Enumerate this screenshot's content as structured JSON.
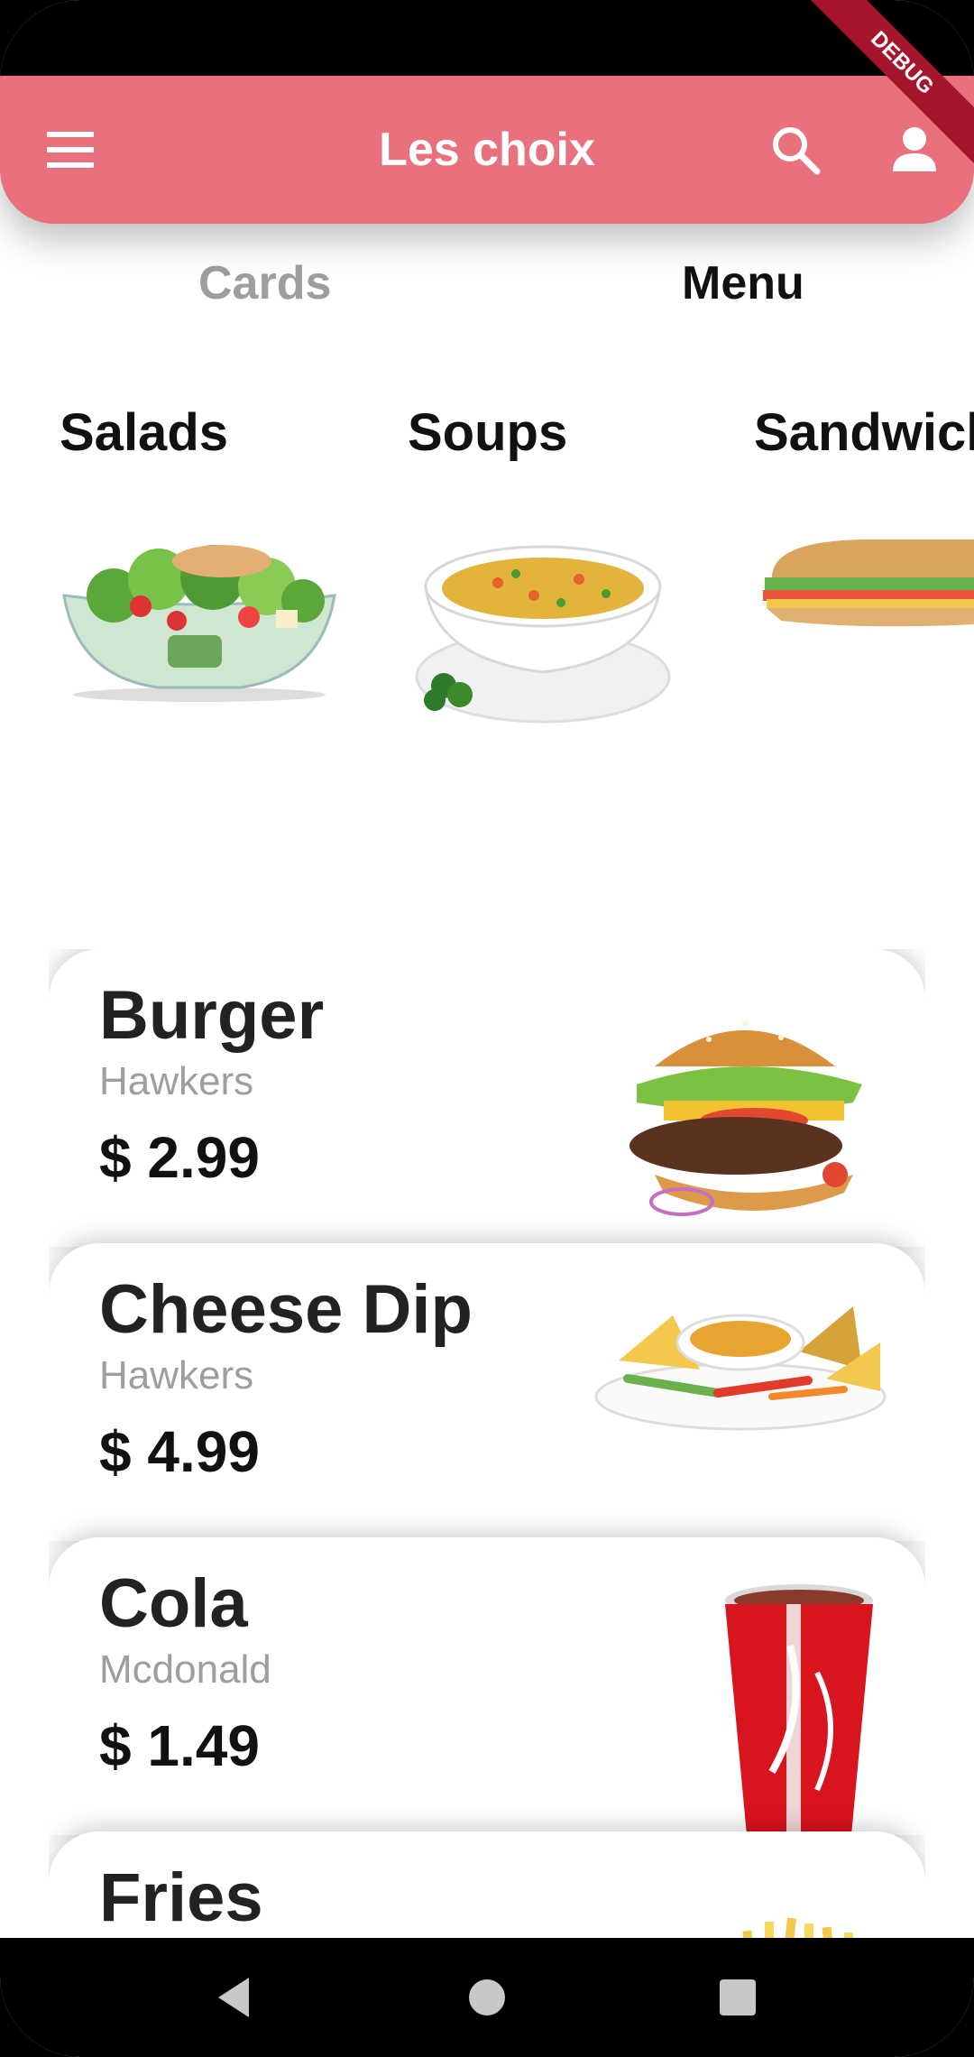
{
  "app_bar": {
    "title": "Les choix",
    "color": "#e8717d",
    "menu_icon": "menu-icon",
    "search_icon": "search-icon",
    "profile_icon": "person-icon"
  },
  "debug_banner": "DEBUG",
  "tabs": [
    {
      "label": "Cards",
      "selected": false
    },
    {
      "label": "Menu",
      "selected": true
    }
  ],
  "categories": [
    {
      "label": "Salads",
      "image": "salad-bowl"
    },
    {
      "label": "Soups",
      "image": "soup-bowl"
    },
    {
      "label": "Sandwiches",
      "image": "sub-sandwich"
    }
  ],
  "cards": [
    {
      "name": "Burger",
      "vendor": "Hawkers",
      "price": "$ 2.99",
      "image": "burger"
    },
    {
      "name": "Cheese Dip",
      "vendor": "Hawkers",
      "price": "$ 4.99",
      "image": "cheese-dip-platter"
    },
    {
      "name": "Cola",
      "vendor": "Mcdonald",
      "price": "$ 1.49",
      "image": "cola-cup"
    },
    {
      "name": "Fries",
      "vendor": "",
      "price": "",
      "image": "fries"
    }
  ],
  "nav_bar": {
    "back_icon": "back-triangle-icon",
    "home_icon": "home-circle-icon",
    "recent_icon": "recent-square-icon"
  }
}
